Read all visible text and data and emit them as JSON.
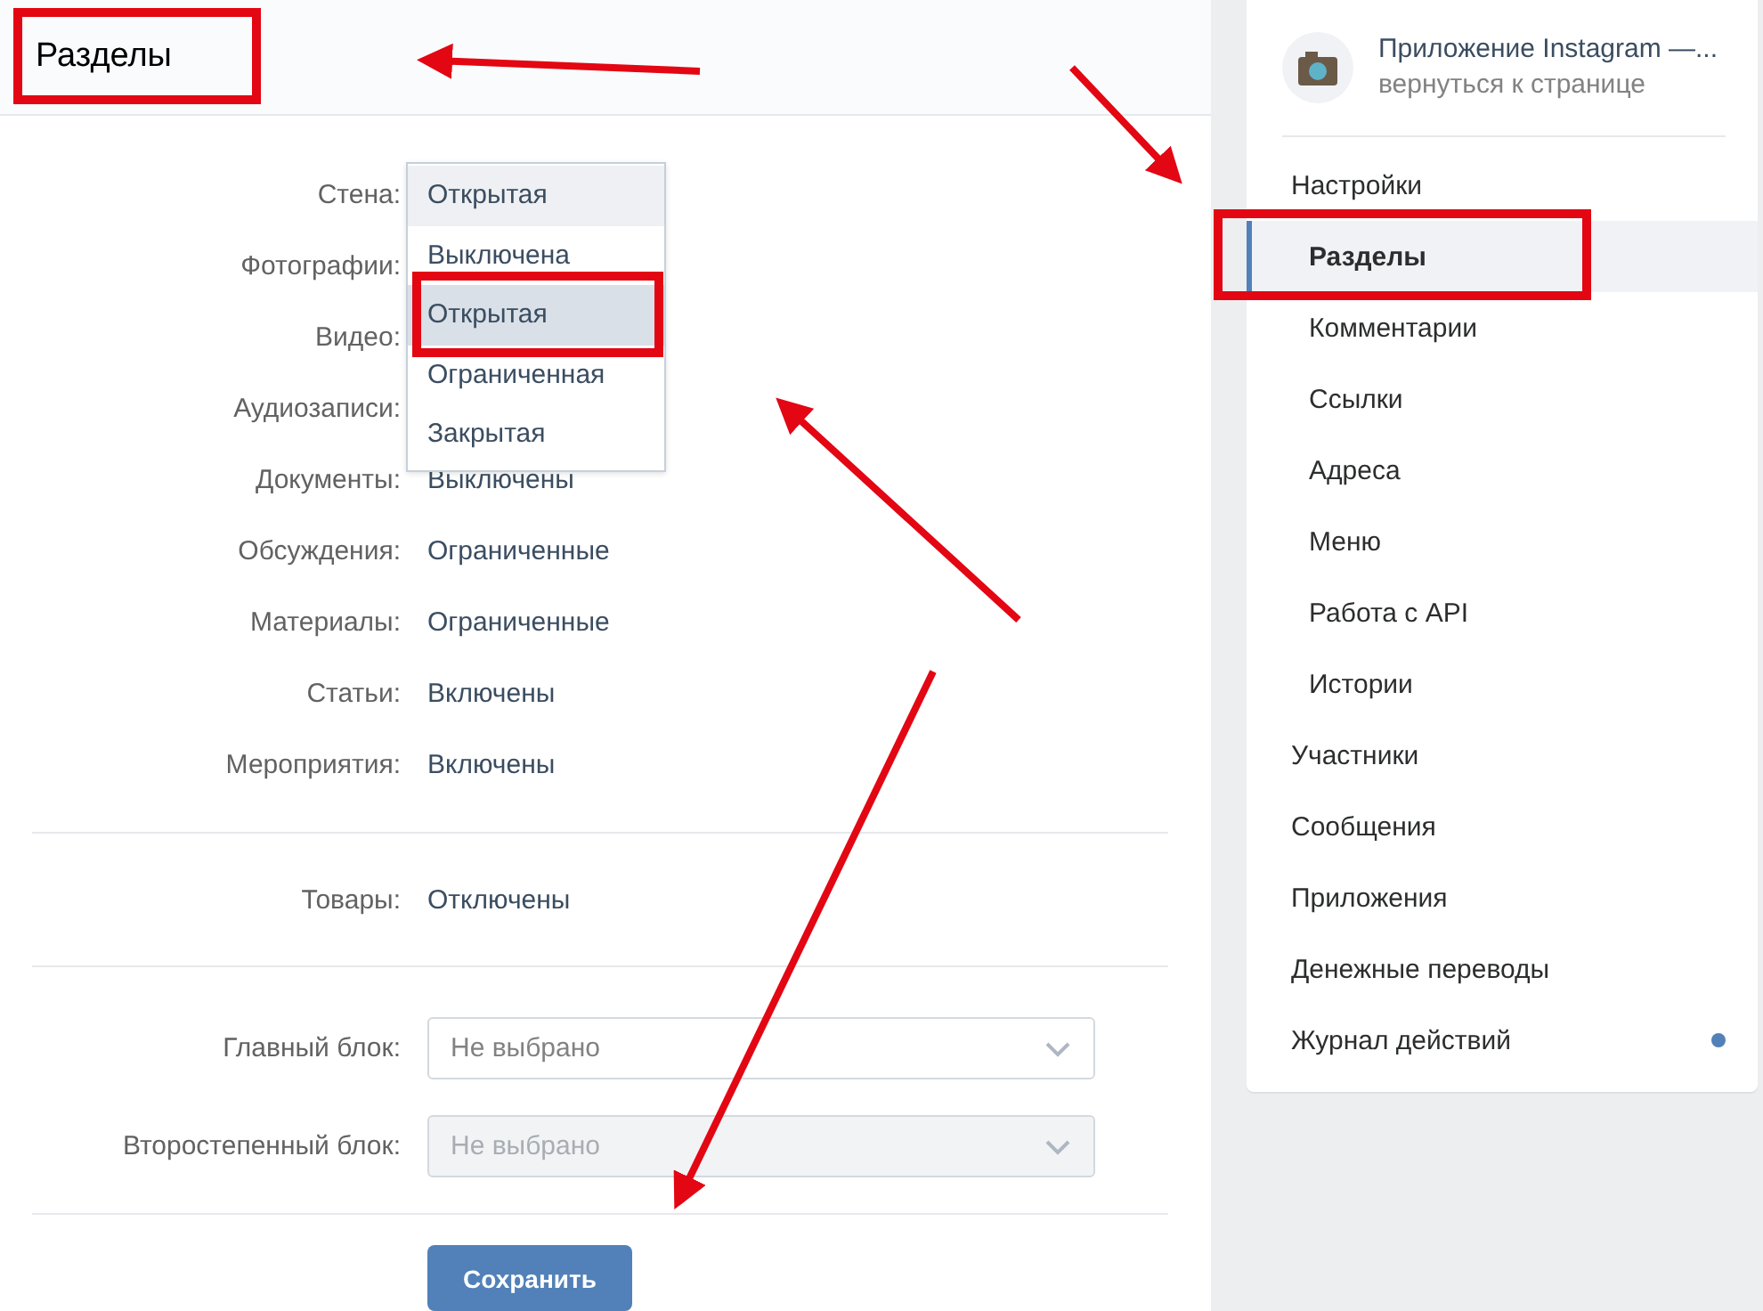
{
  "header": {
    "title": "Разделы"
  },
  "sections": [
    {
      "label": "Стена:"
    },
    {
      "label": "Фотографии:"
    },
    {
      "label": "Видео:"
    },
    {
      "label": "Аудиозаписи:"
    },
    {
      "label": "Документы:",
      "value": "Выключены"
    },
    {
      "label": "Обсуждения:",
      "value": "Ограниченные"
    },
    {
      "label": "Материалы:",
      "value": "Ограниченные"
    },
    {
      "label": "Статьи:",
      "value": "Включены"
    },
    {
      "label": "Мероприятия:",
      "value": "Включены"
    }
  ],
  "goods": {
    "label": "Товары:",
    "value": "Отключены"
  },
  "dropdown": {
    "options": [
      {
        "label": "Открытая",
        "current": true,
        "selected": false
      },
      {
        "label": "Выключена",
        "current": false,
        "selected": false
      },
      {
        "label": "Открытая",
        "current": false,
        "selected": true
      },
      {
        "label": "Ограниченная",
        "current": false,
        "selected": false
      },
      {
        "label": "Закрытая",
        "current": false,
        "selected": false
      }
    ]
  },
  "blocks": [
    {
      "label": "Главный блок:",
      "placeholder": "Не выбрано",
      "disabled": false
    },
    {
      "label": "Второстепенный блок:",
      "placeholder": "Не выбрано",
      "disabled": true
    }
  ],
  "save_button": "Сохранить",
  "app": {
    "title": "Приложение Instagram —...",
    "subtitle": "вернуться к странице"
  },
  "menu": [
    {
      "label": "Настройки",
      "selected": false,
      "children": [
        {
          "label": "Разделы",
          "selected": true
        },
        {
          "label": "Комментарии",
          "selected": false
        },
        {
          "label": "Ссылки",
          "selected": false
        },
        {
          "label": "Адреса",
          "selected": false
        },
        {
          "label": "Меню",
          "selected": false
        },
        {
          "label": "Работа с API",
          "selected": false
        },
        {
          "label": "Истории",
          "selected": false
        }
      ]
    },
    {
      "label": "Участники",
      "selected": false,
      "unread": false
    },
    {
      "label": "Сообщения",
      "selected": false,
      "unread": false
    },
    {
      "label": "Приложения",
      "selected": false,
      "unread": false
    },
    {
      "label": "Денежные переводы",
      "selected": false,
      "unread": false
    },
    {
      "label": "Журнал действий",
      "selected": false,
      "unread": true
    }
  ]
}
